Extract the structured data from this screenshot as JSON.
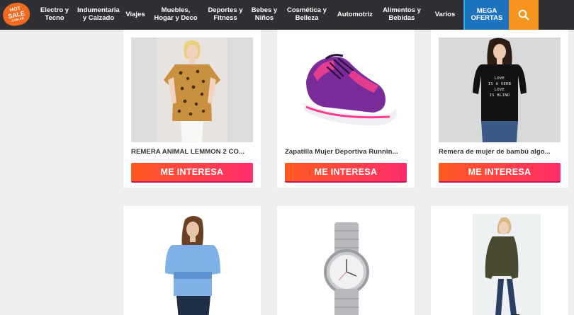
{
  "brand": {
    "logo_line1": "HOT",
    "logo_line2": "SALE",
    "logo_line3": ".COM.AR"
  },
  "nav": {
    "items": [
      {
        "label": "Electro y\nTecno"
      },
      {
        "label": "Indumentaria\ny Calzado"
      },
      {
        "label": "Viajes"
      },
      {
        "label": "Muebles,\nHogar y Deco"
      },
      {
        "label": "Deportes y\nFitness"
      },
      {
        "label": "Bebes y\nNiños"
      },
      {
        "label": "Cosmética y\nBelleza"
      },
      {
        "label": "Automotriz"
      },
      {
        "label": "Alimentos y\nBebidas"
      },
      {
        "label": "Varios"
      }
    ],
    "mega_label": "MEGA\nOFERTAS",
    "search_icon": "search-icon"
  },
  "products": [
    {
      "title": "REMERA ANIMAL LEMMON 2 CO...",
      "button": "ME INTERESA",
      "image": "woman-leopard-top"
    },
    {
      "title": "Zapatilla Mujer Deportiva Runnin...",
      "button": "ME INTERESA",
      "image": "pink-purple-sneaker"
    },
    {
      "title": "Remera de mujer de bambú algo...",
      "button": "ME INTERESA",
      "image": "woman-black-love-shirt"
    },
    {
      "title": "",
      "button": "",
      "image": "woman-blue-sweater"
    },
    {
      "title": "",
      "button": "",
      "image": "silver-watch"
    },
    {
      "title": "",
      "button": "",
      "image": "woman-green-parka"
    }
  ],
  "image_texts": {
    "shirt_lettering": "LOVE\nIS A VERB\nLOVE\nIS BLIND"
  },
  "colors": {
    "nav_bg": "#2f3033",
    "mega_bg": "#1e73be",
    "search_bg": "#f7941d",
    "button_from": "#ff5a1f",
    "button_to": "#ff2d6b"
  }
}
